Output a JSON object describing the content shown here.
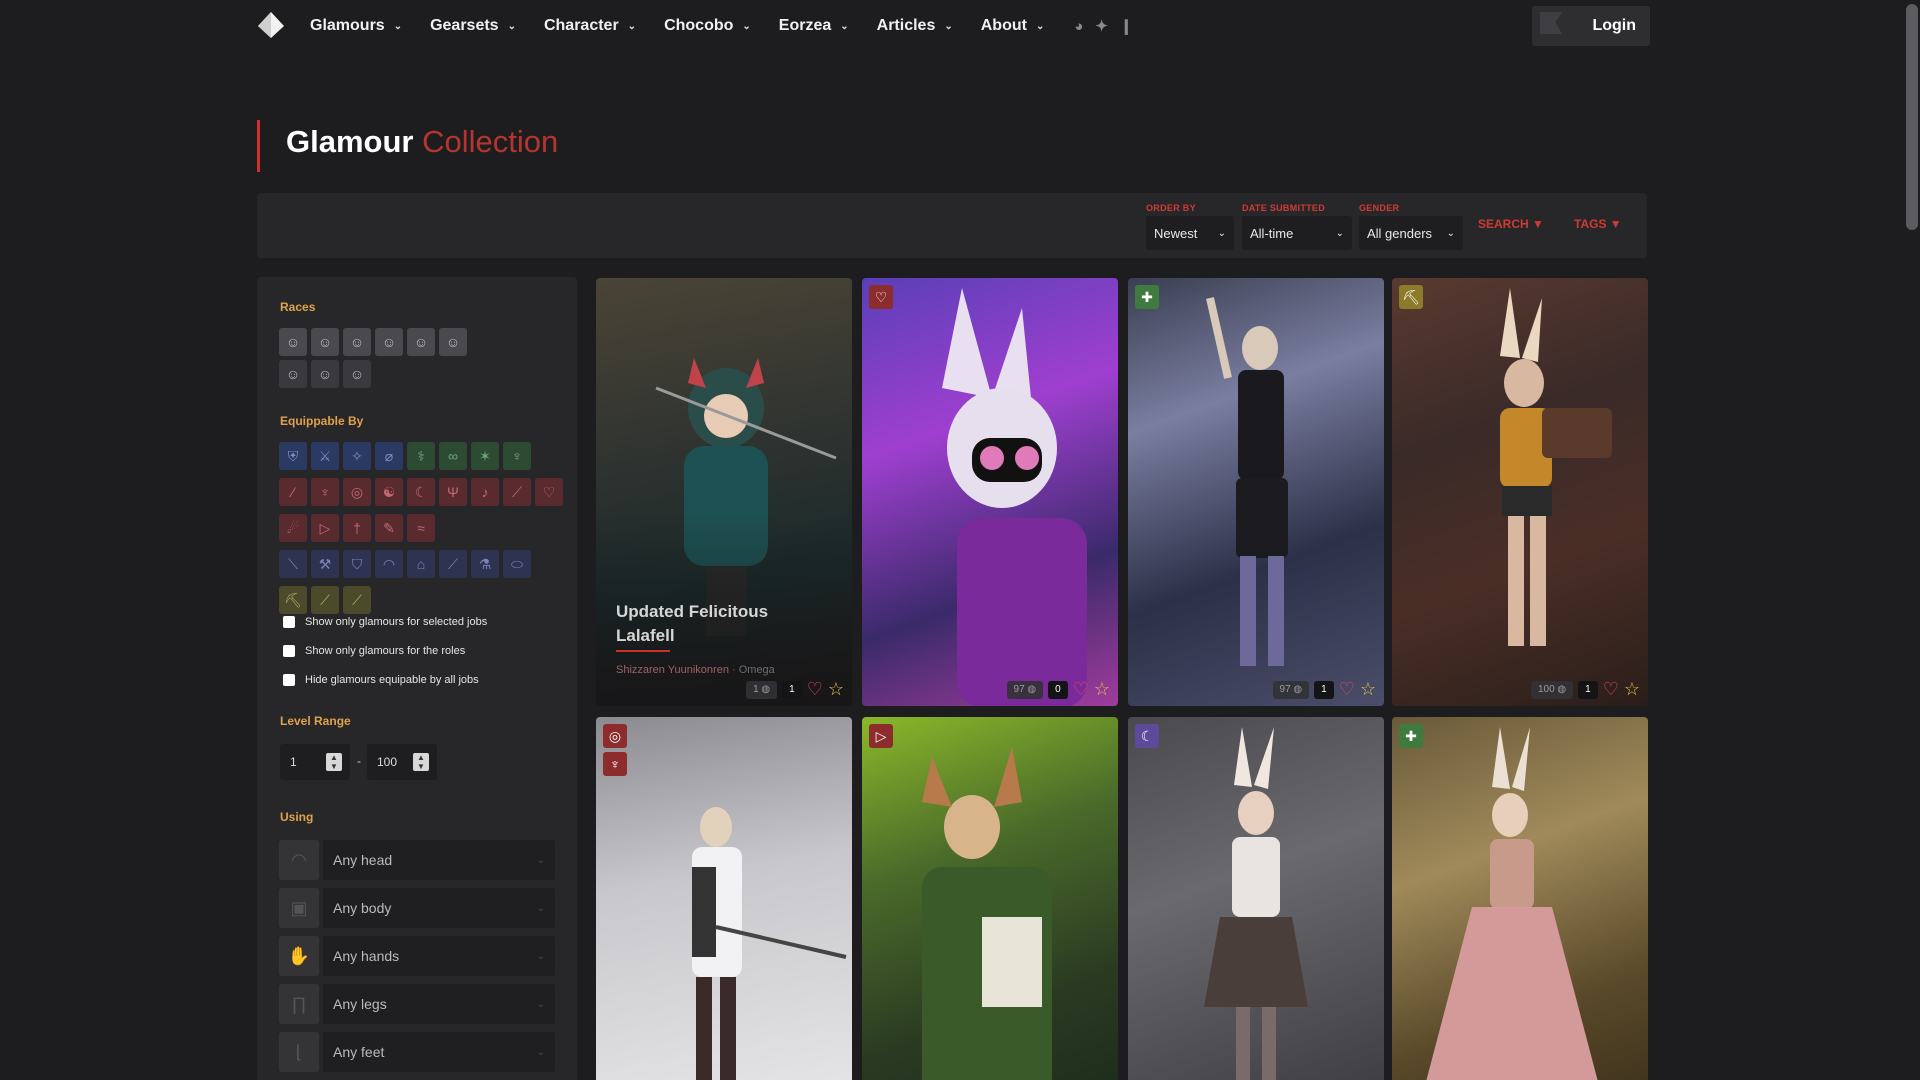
{
  "nav": {
    "items": [
      {
        "label": "Glamours"
      },
      {
        "label": "Gearsets"
      },
      {
        "label": "Character"
      },
      {
        "label": "Chocobo"
      },
      {
        "label": "Eorzea"
      },
      {
        "label": "Articles"
      },
      {
        "label": "About"
      }
    ],
    "login_label": "Login"
  },
  "page": {
    "title_main": "Glamour",
    "title_accent": "Collection"
  },
  "filters": {
    "order_by": {
      "label": "ORDER BY",
      "value": "Newest"
    },
    "date_submitted": {
      "label": "DATE SUBMITTED",
      "value": "All-time"
    },
    "gender": {
      "label": "GENDER",
      "value": "All genders"
    },
    "search_label": "SEARCH ▼",
    "tags_label": "TAGS ▼"
  },
  "sidebar": {
    "races_title": "Races",
    "equippable_title": "Equippable By",
    "checkbox_selected_jobs": "Show only glamours for selected jobs",
    "checkbox_roles": "Show only glamours for the roles",
    "checkbox_hide_all": "Hide glamours equipable by all jobs",
    "level_title": "Level Range",
    "level_min": "1",
    "level_sep": "-",
    "level_max": "100",
    "using_title": "Using",
    "using": [
      {
        "placeholder": "Any head"
      },
      {
        "placeholder": "Any body"
      },
      {
        "placeholder": "Any hands"
      },
      {
        "placeholder": "Any legs"
      },
      {
        "placeholder": "Any feet"
      }
    ]
  },
  "cards": [
    {
      "title": "Updated Felicitous Lalafell",
      "author": "Shizzaren Yuunikonren",
      "world": "Omega",
      "score": "1",
      "count": "1"
    },
    {
      "score": "97",
      "count": "0"
    },
    {
      "score": "97",
      "count": "1"
    },
    {
      "score": "100",
      "count": "1"
    }
  ],
  "colors": {
    "accent": "#d0302d",
    "section_title": "#e0a24a",
    "background": "#1d1d1f",
    "panel": "#27272a"
  }
}
